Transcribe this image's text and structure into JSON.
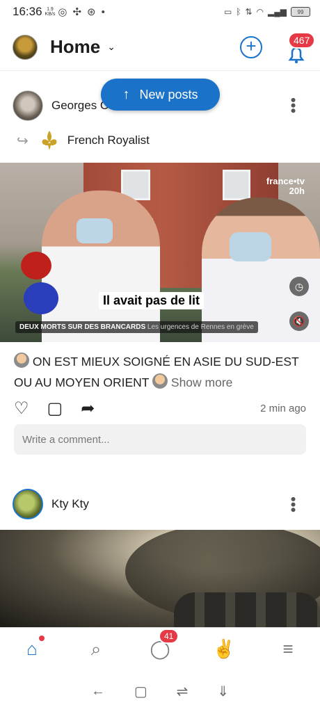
{
  "status_bar": {
    "time": "16:36",
    "speed_value": "1.9",
    "speed_unit": "KB/s",
    "battery": "99"
  },
  "app_bar": {
    "title": "Home",
    "notification_count": "467"
  },
  "new_posts_label": "New posts",
  "post1": {
    "author": "Georges C",
    "shared_to": "French Royalist",
    "video": {
      "brand": "france•tv",
      "channel": "20h",
      "caption": "Il avait pas de lit",
      "headline_bold": "DEUX MORTS SUR DES BRANCARDS",
      "headline_rest": "Les urgences de Rennes en grève"
    },
    "text": "ON EST MIEUX SOIGNÉ EN ASIE DU SUD-EST OU AU MOYEN ORIENT",
    "show_more": "Show more",
    "time": "2 min ago",
    "comment_placeholder": "Write a comment..."
  },
  "post2": {
    "author": "Kty Kty"
  },
  "bottom_nav": {
    "messages_count": "41"
  },
  "icons": {
    "accent": "#1a73c9",
    "badge": "#e53945"
  }
}
